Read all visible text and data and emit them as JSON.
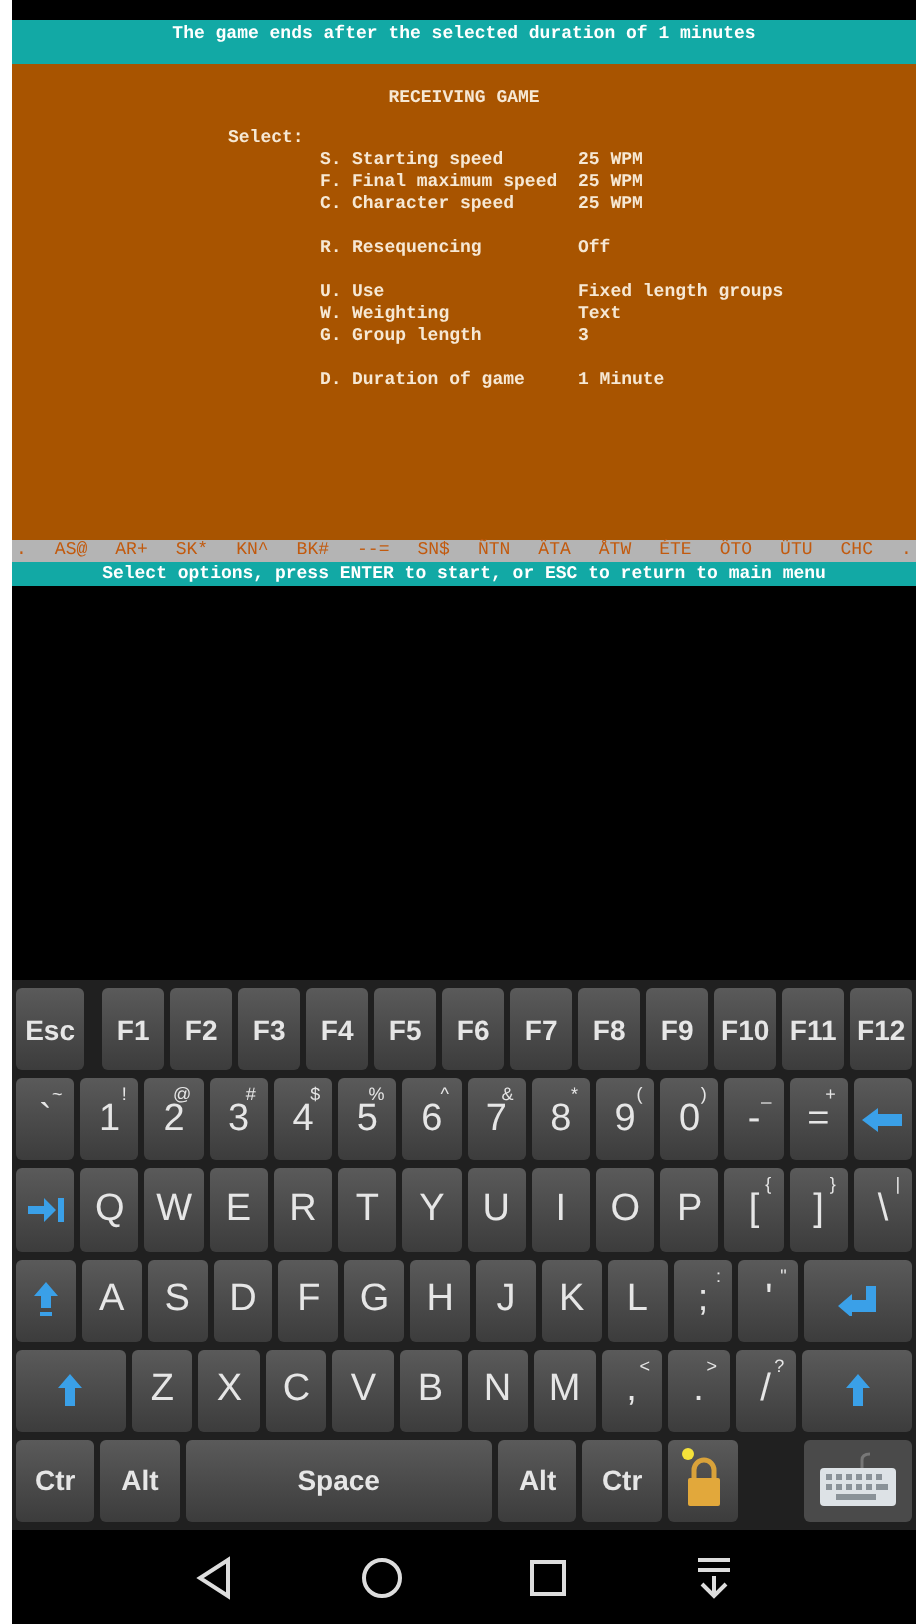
{
  "terminal": {
    "top_message": "The game ends after the selected duration of 1 minutes",
    "title": "RECEIVING GAME",
    "select_label": "Select:",
    "groups": [
      [
        {
          "key": "S.",
          "label": "Starting speed",
          "value": "25 WPM"
        },
        {
          "key": "F.",
          "label": "Final maximum speed",
          "value": "25 WPM"
        },
        {
          "key": "C.",
          "label": "Character speed",
          "value": "25 WPM"
        }
      ],
      [
        {
          "key": "R.",
          "label": "Resequencing",
          "value": "Off"
        }
      ],
      [
        {
          "key": "U.",
          "label": "Use",
          "value": "Fixed length groups"
        },
        {
          "key": "W.",
          "label": "Weighting",
          "value": "Text"
        },
        {
          "key": "G.",
          "label": "Group length",
          "value": "3"
        }
      ],
      [
        {
          "key": "D.",
          "label": "Duration of game",
          "value": "1 Minute"
        }
      ]
    ],
    "prosigns": [
      ".",
      "AS@",
      "AR+",
      "SK*",
      "KN^",
      "BK#",
      "--=",
      "SN$",
      "ÑTN",
      "ÄTA",
      "ÅTW",
      "ÉTE",
      "ÖTO",
      "ÜTU",
      "CHC",
      "."
    ],
    "bottom_message": "Select options, press ENTER to start, or ESC to return to main menu"
  },
  "keyboard": {
    "escape_key": {
      "label": "Esc",
      "kind": "mod"
    },
    "function_keys": [
      {
        "label": "F1",
        "kind": "fn"
      },
      {
        "label": "F2",
        "kind": "fn"
      },
      {
        "label": "F3",
        "kind": "fn"
      },
      {
        "label": "F4",
        "kind": "fn"
      },
      {
        "label": "F5",
        "kind": "fn"
      },
      {
        "label": "F6",
        "kind": "fn"
      },
      {
        "label": "F7",
        "kind": "fn"
      },
      {
        "label": "F8",
        "kind": "fn"
      },
      {
        "label": "F9",
        "kind": "fn"
      },
      {
        "label": "F10",
        "kind": "fn"
      },
      {
        "label": "F11",
        "kind": "fn"
      },
      {
        "label": "F12",
        "kind": "fn"
      }
    ],
    "number_keys": [
      {
        "label": "`",
        "shift": "~",
        "kind": "char"
      },
      {
        "label": "1",
        "shift": "!",
        "kind": "char"
      },
      {
        "label": "2",
        "shift": "@",
        "kind": "char"
      },
      {
        "label": "3",
        "shift": "#",
        "kind": "char"
      },
      {
        "label": "4",
        "shift": "$",
        "kind": "char"
      },
      {
        "label": "5",
        "shift": "%",
        "kind": "char"
      },
      {
        "label": "6",
        "shift": "^",
        "kind": "char"
      },
      {
        "label": "7",
        "shift": "&",
        "kind": "char"
      },
      {
        "label": "8",
        "shift": "*",
        "kind": "char"
      },
      {
        "label": "9",
        "shift": "(",
        "kind": "char"
      },
      {
        "label": "0",
        "shift": ")",
        "kind": "char"
      },
      {
        "label": "-",
        "shift": "_",
        "kind": "char"
      },
      {
        "label": "=",
        "shift": "+",
        "kind": "char"
      },
      {
        "kind": "backspace"
      }
    ],
    "top_letter_keys": [
      {
        "kind": "tab"
      },
      {
        "label": "Q",
        "kind": "char"
      },
      {
        "label": "W",
        "kind": "char"
      },
      {
        "label": "E",
        "kind": "char"
      },
      {
        "label": "R",
        "kind": "char"
      },
      {
        "label": "T",
        "kind": "char"
      },
      {
        "label": "Y",
        "kind": "char"
      },
      {
        "label": "U",
        "kind": "char"
      },
      {
        "label": "I",
        "kind": "char"
      },
      {
        "label": "O",
        "kind": "char"
      },
      {
        "label": "P",
        "kind": "char"
      },
      {
        "label": "[",
        "shift": "{",
        "kind": "char"
      },
      {
        "label": "]",
        "shift": "}",
        "kind": "char"
      },
      {
        "label": "\\",
        "shift": "|",
        "kind": "char"
      }
    ],
    "home_keys": [
      {
        "kind": "capslock"
      },
      {
        "label": "A",
        "kind": "char"
      },
      {
        "label": "S",
        "kind": "char"
      },
      {
        "label": "D",
        "kind": "char"
      },
      {
        "label": "F",
        "kind": "char"
      },
      {
        "label": "G",
        "kind": "char"
      },
      {
        "label": "H",
        "kind": "char"
      },
      {
        "label": "J",
        "kind": "char"
      },
      {
        "label": "K",
        "kind": "char"
      },
      {
        "label": "L",
        "kind": "char"
      },
      {
        "label": ";",
        "shift": ":",
        "kind": "char"
      },
      {
        "label": "'",
        "shift": "\"",
        "kind": "char"
      },
      {
        "kind": "enter"
      }
    ],
    "bottom_letter_keys": [
      {
        "kind": "shift"
      },
      {
        "label": "Z",
        "kind": "char"
      },
      {
        "label": "X",
        "kind": "char"
      },
      {
        "label": "C",
        "kind": "char"
      },
      {
        "label": "V",
        "kind": "char"
      },
      {
        "label": "B",
        "kind": "char"
      },
      {
        "label": "N",
        "kind": "char"
      },
      {
        "label": "M",
        "kind": "char"
      },
      {
        "label": ",",
        "shift": "<",
        "kind": "char"
      },
      {
        "label": ".",
        "shift": ">",
        "kind": "char"
      },
      {
        "label": "/",
        "shift": "?",
        "kind": "char"
      },
      {
        "kind": "shift"
      }
    ],
    "space_bar_keys": [
      {
        "label": "Ctr",
        "kind": "mod"
      },
      {
        "label": "Alt",
        "kind": "mod"
      },
      {
        "label": "Space",
        "kind": "space"
      },
      {
        "label": "Alt",
        "kind": "mod"
      },
      {
        "label": "Ctr",
        "kind": "mod"
      },
      {
        "kind": "lock"
      },
      {
        "kind": "keyboard"
      }
    ]
  }
}
